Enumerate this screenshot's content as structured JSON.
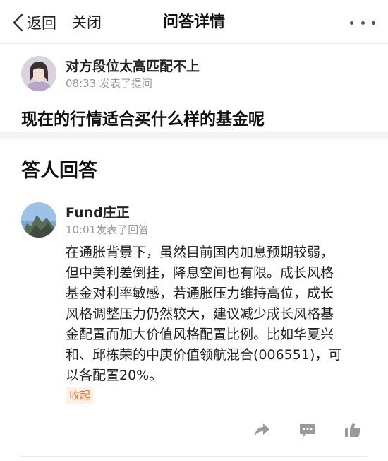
{
  "nav": {
    "back_label": "返回",
    "close_label": "关闭",
    "title": "问答详情"
  },
  "question": {
    "user_name": "对方段位太高匹配不上",
    "meta": "08:33 发表了提问",
    "text": "现在的行情适合买什么样的基金呢"
  },
  "answers": {
    "heading": "答人回答",
    "items": [
      {
        "user_name": "Fund庄正",
        "meta": "10:01发表了回答",
        "lines": [
          "在通胀背景下，虽然目前国内加息预期较弱，",
          "但中美利差倒挂，降息空间也有限。成长风格",
          "基金对利率敏感，若通胀压力维持高位，成长",
          "风格调整压力仍然较大，建议减少成长风格基",
          "金配置而加大价值风格配置比例。比如华夏兴",
          "和、邱栋荣的中庚价值领航混合(006551)，可",
          "以各配置20%。"
        ],
        "collapse_label": "收起"
      }
    ]
  },
  "colors": {
    "accent": "#e07a3c",
    "accent_bg": "#fdf1e8",
    "meta_gray": "#999999",
    "icon_gray": "#9a9a9a"
  },
  "icons": {
    "back": "chevron-left-icon",
    "more": "more-horizontal-icon",
    "share": "share-icon",
    "comment": "comment-icon",
    "like": "thumbs-up-icon"
  }
}
